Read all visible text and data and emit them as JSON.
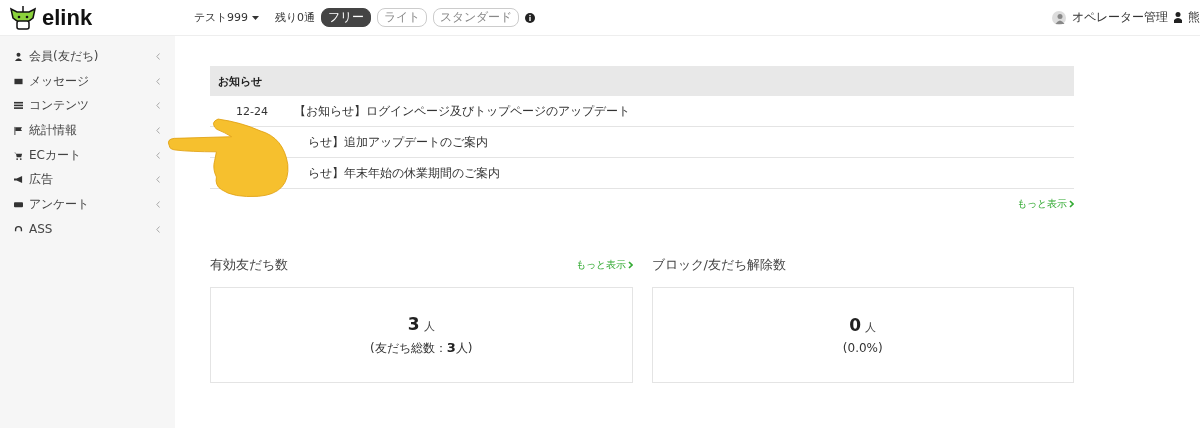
{
  "header": {
    "logo_text": "elink",
    "account": "テスト999",
    "remaining": "残り0通",
    "plans": [
      {
        "label": "フリー",
        "selected": true
      },
      {
        "label": "ライト",
        "selected": false
      },
      {
        "label": "スタンダード",
        "selected": false
      }
    ],
    "operator_link": "オペレーター管理",
    "user_name": "熊"
  },
  "sidebar": {
    "items": [
      {
        "label": "会員(友だち)"
      },
      {
        "label": "メッセージ"
      },
      {
        "label": "コンテンツ"
      },
      {
        "label": "統計情報"
      },
      {
        "label": "ECカート"
      },
      {
        "label": "広告"
      },
      {
        "label": "アンケート"
      },
      {
        "label": "ASS"
      }
    ]
  },
  "notices": {
    "title": "お知らせ",
    "rows": [
      {
        "date": "12-24",
        "title": "【お知らせ】ログインページ及びトップページのアップデート"
      },
      {
        "title": "らせ】追加アップデートのご案内"
      },
      {
        "title": "らせ】年末年始の休業期間のご案内"
      }
    ],
    "more": "もっと表示"
  },
  "stats": [
    {
      "title": "有効友だち数",
      "more": "もっと表示",
      "value": "3",
      "unit": "人",
      "sub_prefix": "(友だち総数：",
      "sub_value": "3",
      "sub_suffix": "人)"
    },
    {
      "title": "ブロック/友だち解除数",
      "value": "0",
      "unit": "人",
      "sub_prefix": "(0.0%)"
    }
  ]
}
